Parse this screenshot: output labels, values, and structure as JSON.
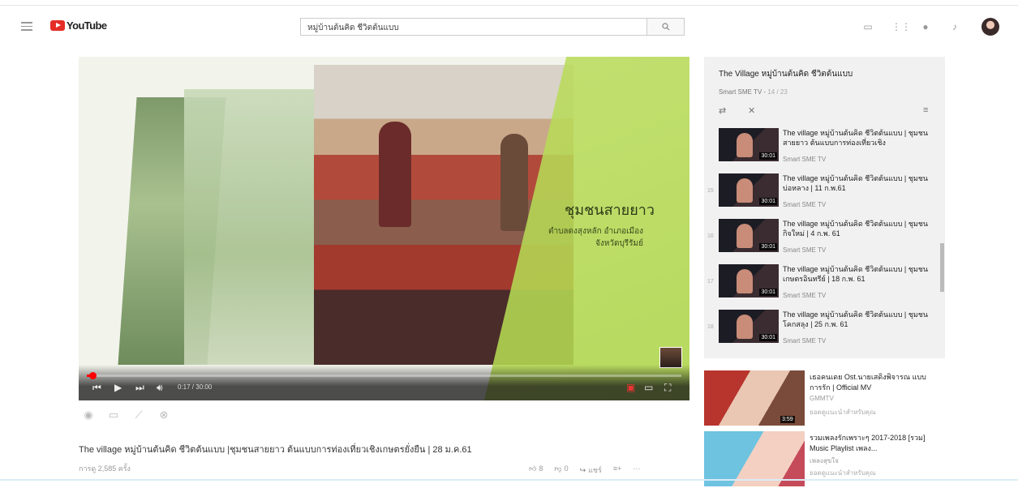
{
  "app": {
    "logo_text": "YouTube"
  },
  "search": {
    "value": "หมู่บ้านต้นคิด ชีวิตต้นแบบ",
    "icon": "search-icon"
  },
  "player": {
    "overlay_title": "ชุมชนสายยาว",
    "overlay_sub1": "ตำบลดงสุงหลัก อำเภอเมือง",
    "overlay_sub2": "จังหวัดบุรีรัมย์",
    "time": "0:17 / 30:00",
    "progress_fraction": 0.01
  },
  "video": {
    "title": "The village หมู่บ้านต้นคิด ชีวิตต้นแบบ |ชุมชนสายยาว ต้นแบบการท่องเที่ยวเชิงเกษตรยั่งยืน | 28 ม.ค.61",
    "views": "การดู 2,585 ครั้ง",
    "likes": "8",
    "dislikes": "0",
    "share_label": "แชร์"
  },
  "playlist": {
    "title": "The Village หมู่บ้านต้นคิด ชีวิตต้นแบบ",
    "channel": "Smart SME TV",
    "position": "14 / 23",
    "items": [
      {
        "num": "",
        "title": "The village หมู่บ้านต้นคิด ชีวิตต้นแบบ | ชุมชนสายยาว ต้นแบบการท่องเที่ยวเชิง",
        "channel": "Smart SME TV",
        "duration": "30:01"
      },
      {
        "num": "15",
        "title": "The village หมู่บ้านต้นคิด ชีวิตต้นแบบ | ชุมชนบ่อหลาง | 11 ก.พ.61",
        "channel": "Smart SME TV",
        "duration": "30:01"
      },
      {
        "num": "16",
        "title": "The village หมู่บ้านต้นคิด ชีวิตต้นแบบ | ชุมชนกิจใหม่ | 4 ก.พ. 61",
        "channel": "Smart SME TV",
        "duration": "30:01"
      },
      {
        "num": "17",
        "title": "The village หมู่บ้านต้นคิด ชีวิตต้นแบบ | ชุมชนเกษตรอินทรีย์ | 18 ก.พ. 61",
        "channel": "Smart SME TV",
        "duration": "30:01"
      },
      {
        "num": "18",
        "title": "The village หมู่บ้านต้นคิด ชีวิตต้นแบบ | ชุมชนโคกสลุง | 25 ก.พ. 61",
        "channel": "Smart SME TV",
        "duration": "30:01"
      }
    ]
  },
  "recommended": [
    {
      "title": "เธอคนเดย Ost.นายเสดิงพิจารณ แบบ การรัก | Official MV",
      "channel": "GMMTV",
      "views": "ยอดดูแนะนำสำหรับคุณ",
      "duration": "3:59"
    },
    {
      "title": "รวมเพลงรักเพราะๆ 2017-2018 [รวม] Music Playlist เพลง...",
      "channel": "เพลงสุขใจ",
      "views": "ยอดดูแนะนำสำหรับคุณ",
      "duration": ""
    }
  ]
}
